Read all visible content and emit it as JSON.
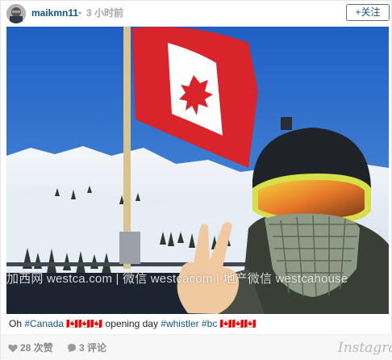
{
  "header": {
    "username": "maikmn11",
    "dot": "•",
    "timestamp": "3 小时前",
    "follow_label": "+关注"
  },
  "photo": {
    "watermark": "加西网 westca.com | 微信 westcacom | 地产微信 westcahouse"
  },
  "caption": {
    "prefix": "Oh ",
    "tag_canada": "#Canada",
    "mid1": " 🇨🇦🇨🇦🇨🇦 opening day ",
    "tag_whistler": "#whistler",
    "space": " ",
    "tag_bc": "#bc",
    "suffix": " 🇨🇦🇨🇦🇨🇦"
  },
  "footer": {
    "likes": "28 次赞",
    "comments": "3 评论",
    "brand": "Instagram"
  },
  "colors": {
    "link": "#125688",
    "sky": "#2d6fc9",
    "flag_red": "#d8242a"
  }
}
